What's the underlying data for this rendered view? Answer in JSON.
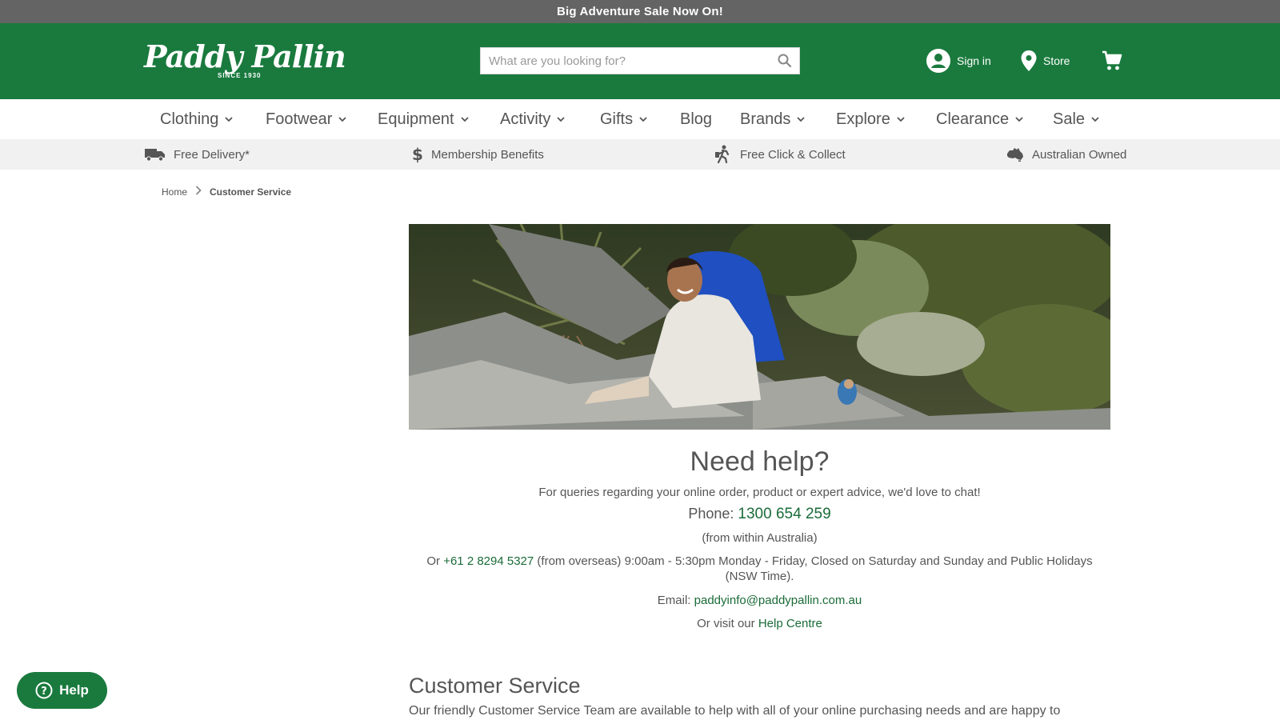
{
  "promo": {
    "text": "Big Adventure Sale Now On!"
  },
  "header": {
    "logo": {
      "script": "Paddy Pallin",
      "since": "SINCE 1930"
    },
    "search": {
      "placeholder": "What are you looking for?"
    },
    "sign_in": "Sign in",
    "store": "Store"
  },
  "nav": {
    "items": [
      {
        "label": "Clothing",
        "has_dropdown": true
      },
      {
        "label": "Footwear",
        "has_dropdown": true
      },
      {
        "label": "Equipment",
        "has_dropdown": true
      },
      {
        "label": "Activity",
        "has_dropdown": true
      },
      {
        "label": "Gifts",
        "has_dropdown": true
      },
      {
        "label": "Blog",
        "has_dropdown": false
      },
      {
        "label": "Brands",
        "has_dropdown": true
      },
      {
        "label": "Explore",
        "has_dropdown": true
      },
      {
        "label": "Clearance",
        "has_dropdown": true
      },
      {
        "label": "Sale",
        "has_dropdown": true
      }
    ]
  },
  "usp": {
    "items": [
      {
        "label": "Free Delivery*",
        "icon": "truck-icon"
      },
      {
        "label": "Membership Benefits",
        "icon": "dollar-icon"
      },
      {
        "label": "Free Click & Collect",
        "icon": "walker-icon"
      },
      {
        "label": "Australian Owned",
        "icon": "australia-icon"
      }
    ]
  },
  "breadcrumb": {
    "home": "Home",
    "current": "Customer Service"
  },
  "help": {
    "title": "Need help?",
    "intro": "For queries regarding your online order, product or expert advice, we'd love to chat!",
    "phone_label": "Phone:",
    "phone": "1300 654 259",
    "phone_note": "(from within Australia)",
    "or": "Or",
    "overseas_phone": "+61 2 8294 5327",
    "overseas_note": "(from overseas) 9:00am - 5:30pm Monday - Friday, Closed on Saturday and Sunday and Public Holidays (NSW Time).",
    "email_label": "Email:",
    "email": "paddyinfo@paddypallin.com.au",
    "visit_label": "Or visit our",
    "help_centre": "Help Centre"
  },
  "customer_service": {
    "title": "Customer Service",
    "text": "Our friendly Customer Service Team are available to help with all of your online purchasing needs and are happy to"
  },
  "help_widget": {
    "label": "Help"
  },
  "colors": {
    "brand_green": "#1a7a3e",
    "link_green": "#1a6b38",
    "promo_grey": "#646464",
    "usp_grey": "#f1f1f1"
  }
}
